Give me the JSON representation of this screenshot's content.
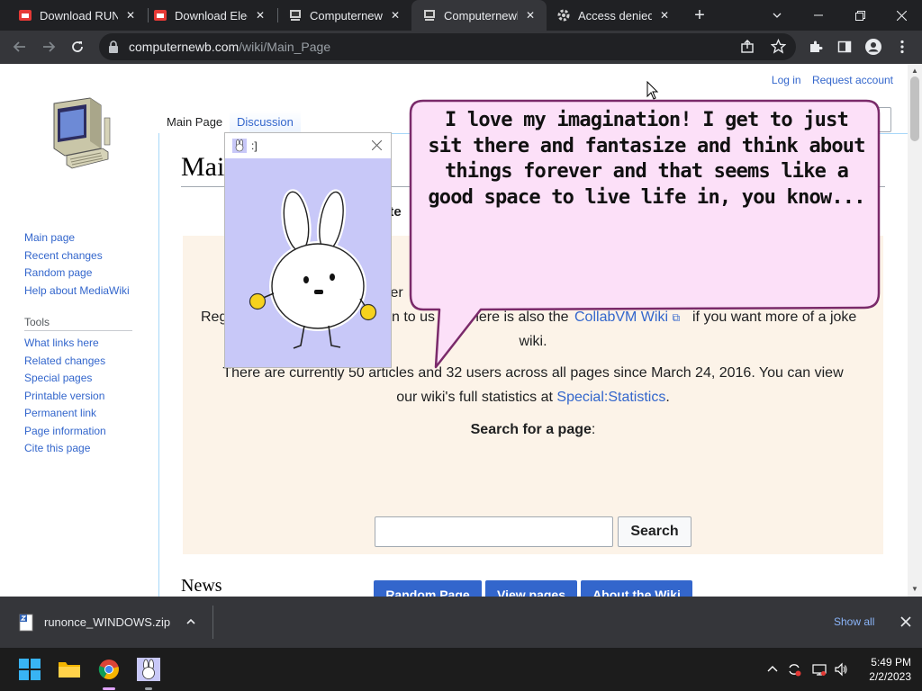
{
  "browser": {
    "tabs": [
      {
        "title": "Download RUNONCE",
        "favicon": "red-square-icon",
        "active": false
      },
      {
        "title": "Download Electron",
        "favicon": "red-square-icon",
        "active": false
      },
      {
        "title": "Computernewb Wiki",
        "favicon": "computer-icon",
        "active": false
      },
      {
        "title": "Computernewb Wiki",
        "favicon": "computer-icon",
        "active": true
      },
      {
        "title": "Access denied",
        "favicon": "gear-icon",
        "active": false
      }
    ],
    "address": {
      "domain": "computernewb.com",
      "path": "/wiki/Main_Page"
    }
  },
  "wiki": {
    "personal": {
      "login": "Log in",
      "request": "Request account"
    },
    "nav": [
      "Main page",
      "Recent changes",
      "Random page",
      "Help about MediaWiki"
    ],
    "tools_heading": "Tools",
    "tools": [
      "What links here",
      "Related changes",
      "Special pages",
      "Printable version",
      "Permanent link",
      "Page information",
      "Cite this page"
    ],
    "tabs": {
      "main": "Main Page",
      "discussion": "Discussion"
    },
    "heading": "Mai",
    "welcome_fragment": "ate",
    "line1_fragment": "ter",
    "line2": {
      "a": "Reg",
      "b": "n to us",
      "c": "here is also the",
      "link": "CollabVM Wiki",
      "d": "if you want more of a joke"
    },
    "line3": "wiki.",
    "stats1": "There are currently 50 articles and 32 users across all pages since March 24, 2016. You can view",
    "stats2_pre": "our wiki's full statistics at",
    "stats2_link": "Special:Statistics",
    "stats2_post": ".",
    "search_label": "Search for a page",
    "search_colon": ":",
    "search_button": "Search",
    "buttons": [
      "Random Page",
      "View pages",
      "About the Wiki"
    ],
    "news_heading": "News"
  },
  "popup": {
    "title": ":]",
    "bubble_text": "I love my imagination! I get to just sit there and fantasize and think about things forever and that seems like a good space to live life in, you know..."
  },
  "download": {
    "filename": "runonce_WINDOWS.zip",
    "show_all": "Show all"
  },
  "taskbar": {
    "time": "5:49 PM",
    "date": "2/2/2023"
  },
  "colors": {
    "link": "#3366cc",
    "button_blue": "#3366cc",
    "infobox_bg": "#fcf3e8",
    "bunny_bg": "#c8c8f8",
    "bubble_fill": "#fce0f8",
    "bubble_stroke": "#7a2a6a"
  }
}
